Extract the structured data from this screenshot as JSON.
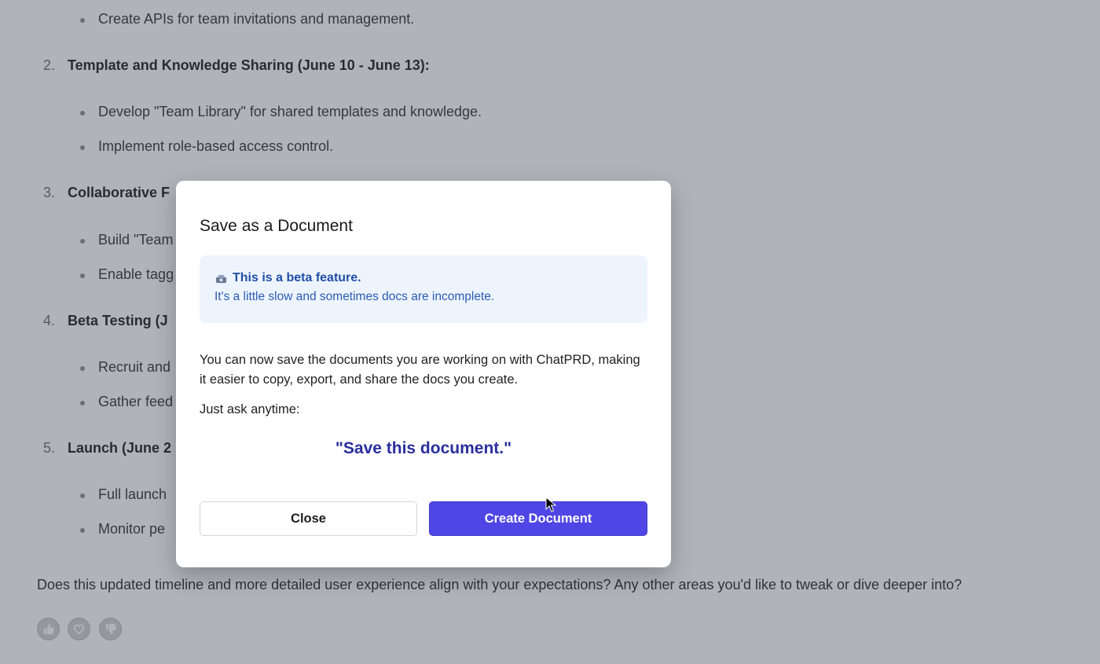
{
  "background": {
    "top_bullet": "Create APIs for team invitations and management.",
    "sections": [
      {
        "number": "2.",
        "title": "Template and Knowledge Sharing (June 10 - June 13):",
        "bullets": [
          "Develop \"Team Library\" for shared templates and knowledge.",
          "Implement role-based access control."
        ]
      },
      {
        "number": "3.",
        "title": "Collaborative F",
        "bullets": [
          "Build \"Team",
          "Enable tagg"
        ]
      },
      {
        "number": "4.",
        "title": "Beta Testing (J",
        "bullets": [
          "Recruit and",
          "Gather feed"
        ]
      },
      {
        "number": "5.",
        "title": "Launch (June 2",
        "bullets": [
          "Full launch",
          "Monitor pe"
        ]
      }
    ],
    "closing_text": "Does this updated timeline and more detailed user experience align with your expectations? Any other areas you'd like to tweak or dive deeper into?",
    "feedback_icons": [
      "thumbs-up-icon",
      "heart-icon",
      "thumbs-down-icon"
    ]
  },
  "modal": {
    "title": "Save as a Document",
    "beta_notice": {
      "icon": "beta-badge-icon",
      "title": "This is a beta feature.",
      "subtitle": "It's a little slow and sometimes docs are incomplete."
    },
    "description": "You can now save the documents you are working on with ChatPRD, making it easier to copy, export, and share the docs you create.",
    "ask_label": "Just ask anytime:",
    "quote": "\"Save this document.\"",
    "close_label": "Close",
    "create_label": "Create Document"
  },
  "colors": {
    "overlay": "#464a5c",
    "beta_box": "#eef4fd",
    "beta_text": "#1f4fa6",
    "quote_text": "#2a2f9c",
    "primary_button": "#4f46e5"
  }
}
